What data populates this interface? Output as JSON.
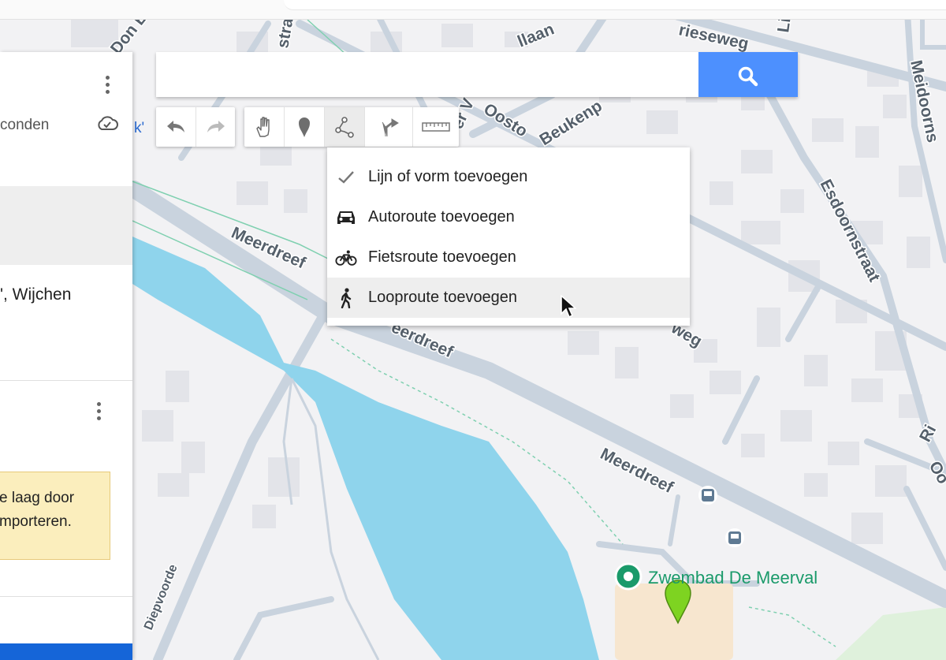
{
  "panel": {
    "saved_text": "conden",
    "place_text": "', Wijchen",
    "tip_line1": "e laag door",
    "tip_line2": "mporteren."
  },
  "search": {
    "value": "",
    "placeholder": "",
    "button_icon": "search-icon"
  },
  "toolbar": {
    "buttons": [
      "undo-icon",
      "redo-icon",
      "hand-icon",
      "marker-icon",
      "draw-line-icon",
      "directions-icon",
      "ruler-icon"
    ],
    "active": "draw-line-icon"
  },
  "menu": {
    "items": [
      {
        "label": "Lijn of vorm toevoegen",
        "icon": "check-icon"
      },
      {
        "label": "Autoroute toevoegen",
        "icon": "car-icon"
      },
      {
        "label": "Fietsroute toevoegen",
        "icon": "bicycle-icon"
      },
      {
        "label": "Looproute toevoegen",
        "icon": "walking-icon"
      }
    ],
    "hovered_index": 3
  },
  "map": {
    "streets": {
      "don": "Don E",
      "straat1": "straa",
      "laan": "llaan",
      "rieseweg": "rieseweg",
      "ve": "er V",
      "oost": "Oosto",
      "beuken": "Beukenp",
      "esdoorn": "Esdoornstraat",
      "meidoorn": "Meidoorns",
      "meerdreef1": "Meerdreef",
      "meerdreef2": "eerdreef",
      "meerdreef3": "Meerdreef",
      "weg": "weg",
      "diepvoorde": "Diepvoorde",
      "li": "Li",
      "ri": "Ri",
      "oo": "Oo"
    },
    "poi_name": "Zwembad De Meerval",
    "k_fragment": "k'"
  },
  "colors": {
    "water": "#8fd4ec",
    "road": "#c5d0dc",
    "search_button": "#4d90fe",
    "poi_green": "#1a9a6a",
    "marker_lime": "#7ed321",
    "tip_bg": "#fbeebd"
  }
}
